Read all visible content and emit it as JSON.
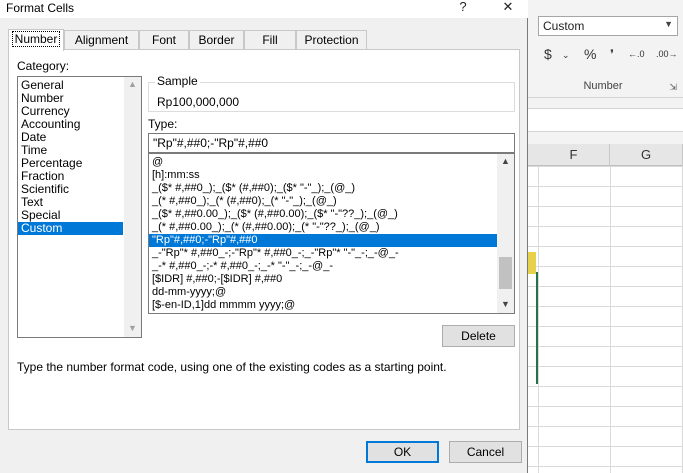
{
  "dialog": {
    "title": "Format Cells",
    "help_glyph": "?",
    "close_glyph": "✕",
    "tabs": [
      {
        "label": "Number"
      },
      {
        "label": "Alignment"
      },
      {
        "label": "Font"
      },
      {
        "label": "Border"
      },
      {
        "label": "Fill"
      },
      {
        "label": "Protection"
      }
    ],
    "active_tab": "Number",
    "category_label": "Category:",
    "categories": [
      "General",
      "Number",
      "Currency",
      "Accounting",
      "Date",
      "Time",
      "Percentage",
      "Fraction",
      "Scientific",
      "Text",
      "Special",
      "Custom"
    ],
    "selected_category": "Custom",
    "sample_label": "Sample",
    "sample_value": "Rp100,000,000",
    "type_label": "Type:",
    "type_value": "\"Rp\"#,##0;-\"Rp\"#,##0",
    "type_list": [
      "@",
      "[h]:mm:ss",
      "_($* #,##0_);_($* (#,##0);_($* \"-\"_);_(@_)",
      "_(* #,##0_);_(* (#,##0);_(* \"-\"_);_(@_)",
      "_($* #,##0.00_);_($* (#,##0.00);_($* \"-\"??_);_(@_)",
      "_(* #,##0.00_);_(* (#,##0.00);_(* \"-\"??_);_(@_)",
      "\"Rp\"#,##0;-\"Rp\"#,##0",
      "_-\"Rp\"* #,##0_-;-\"Rp\"* #,##0_-;_-\"Rp\"* \"-\"_-;_-@_-",
      "_-* #,##0_-;-* #,##0_-;_-* \"-\"_-;_-@_-",
      "[$IDR] #,##0;-[$IDR] #,##0",
      "dd-mm-yyyy;@",
      "[$-en-ID,1]dd mmmm yyyy;@"
    ],
    "selected_type_index": 6,
    "delete_label": "Delete",
    "hint": "Type the number format code, using one of the existing codes as a starting point.",
    "ok_label": "OK",
    "cancel_label": "Cancel"
  },
  "excel": {
    "number_format_combo": "Custom",
    "currency_symbol": "$",
    "percent_symbol": "%",
    "comma_symbol": "❜",
    "increase_decimal": "←.0",
    "decrease_decimal": ".00→",
    "group_label": "Number",
    "columns": [
      "F",
      "G"
    ]
  }
}
